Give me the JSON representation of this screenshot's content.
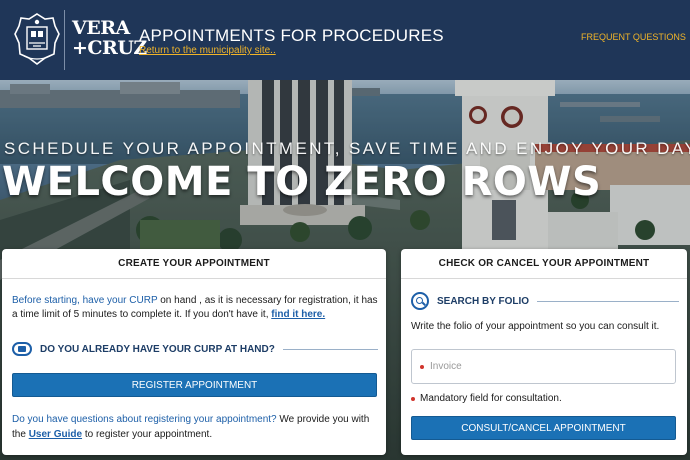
{
  "header": {
    "title": "APPOINTMENTS FOR PROCEDURES",
    "subtitle": "Return to the municipality site..",
    "logo_line1": "VERA",
    "logo_line2": "+CRUZ",
    "faq_label": "FREQUENT QUESTIONS"
  },
  "hero": {
    "tagline": "SCHEDULE YOUR APPOINTMENT, SAVE TIME AND ENJOY YOUR DAY",
    "title": "WELCOME TO ZERO ROWS"
  },
  "create_card": {
    "header": "CREATE YOUR APPOINTMENT",
    "intro_blue": "Before starting, have your CURP",
    "intro_rest": " on hand , as it is necessary for registration, it has a time limit of 5 minutes to complete it. If you don't have it, ",
    "intro_link": "find it here.",
    "curp_question": "DO YOU ALREADY HAVE YOUR CURP AT HAND?",
    "register_button": "REGISTER APPOINTMENT",
    "guide_blue": "Do you have questions about registering your appointment?",
    "guide_mid": " We provide you with the ",
    "guide_link": "User Guide",
    "guide_end": " to register your appointment."
  },
  "check_card": {
    "header": "CHECK OR CANCEL YOUR APPOINTMENT",
    "search_label": "SEARCH BY FOLIO",
    "description": "Write the folio of your appointment so you can consult it.",
    "input_placeholder": "Invoice",
    "input_value": "",
    "mandatory_text": "Mandatory field for consultation.",
    "consult_button": "CONSULT/CANCEL APPOINTMENT"
  },
  "icons": {
    "seal": "municipal-seal-icon",
    "curp": "id-card-icon",
    "search": "search-icon"
  },
  "colors": {
    "header_bg": "#1f3658",
    "accent": "#f0b429",
    "primary_button": "#1b71b5",
    "link": "#1d5fa8",
    "required": "#d0342c"
  }
}
